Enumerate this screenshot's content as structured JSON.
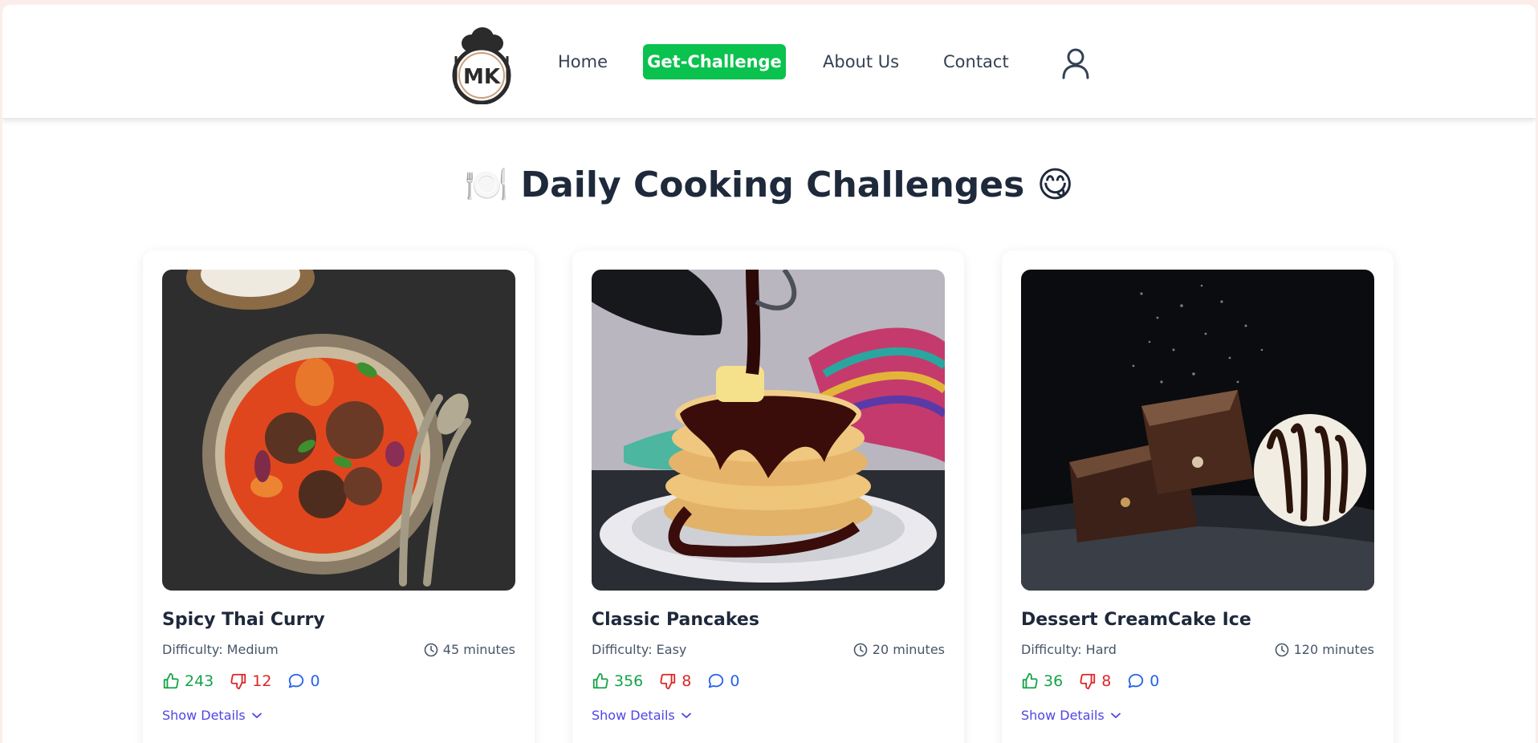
{
  "nav": {
    "logo_text": "MK",
    "home": "Home",
    "challenge": "Get-Challenge",
    "about": "About Us",
    "contact": "Contact",
    "accent": "#0ac24e"
  },
  "page": {
    "title_emoji_left": "🍽️",
    "title": "Daily Cooking Challenges",
    "title_emoji_right": "😋"
  },
  "cards": [
    {
      "title": "Spicy Thai Curry",
      "difficulty": "Difficulty: Medium",
      "time": "45 minutes",
      "likes": "243",
      "dislikes": "12",
      "comments": "0",
      "details": "Show Details"
    },
    {
      "title": "Classic Pancakes",
      "difficulty": "Difficulty: Easy",
      "time": "20 minutes",
      "likes": "356",
      "dislikes": "8",
      "comments": "0",
      "details": "Show Details"
    },
    {
      "title": "Dessert CreamCake Ice",
      "difficulty": "Difficulty: Hard",
      "time": "120 minutes",
      "likes": "36",
      "dislikes": "8",
      "comments": "0",
      "details": "Show Details"
    }
  ],
  "icons": [
    "chef-hat-logo-icon",
    "user-icon",
    "clock-icon",
    "thumbs-up-icon",
    "thumbs-down-icon",
    "comment-icon",
    "chevron-down-icon"
  ],
  "colors": {
    "like": "#16a34a",
    "dislike": "#dc2626",
    "comment": "#2563eb",
    "link": "#4f46e5"
  }
}
